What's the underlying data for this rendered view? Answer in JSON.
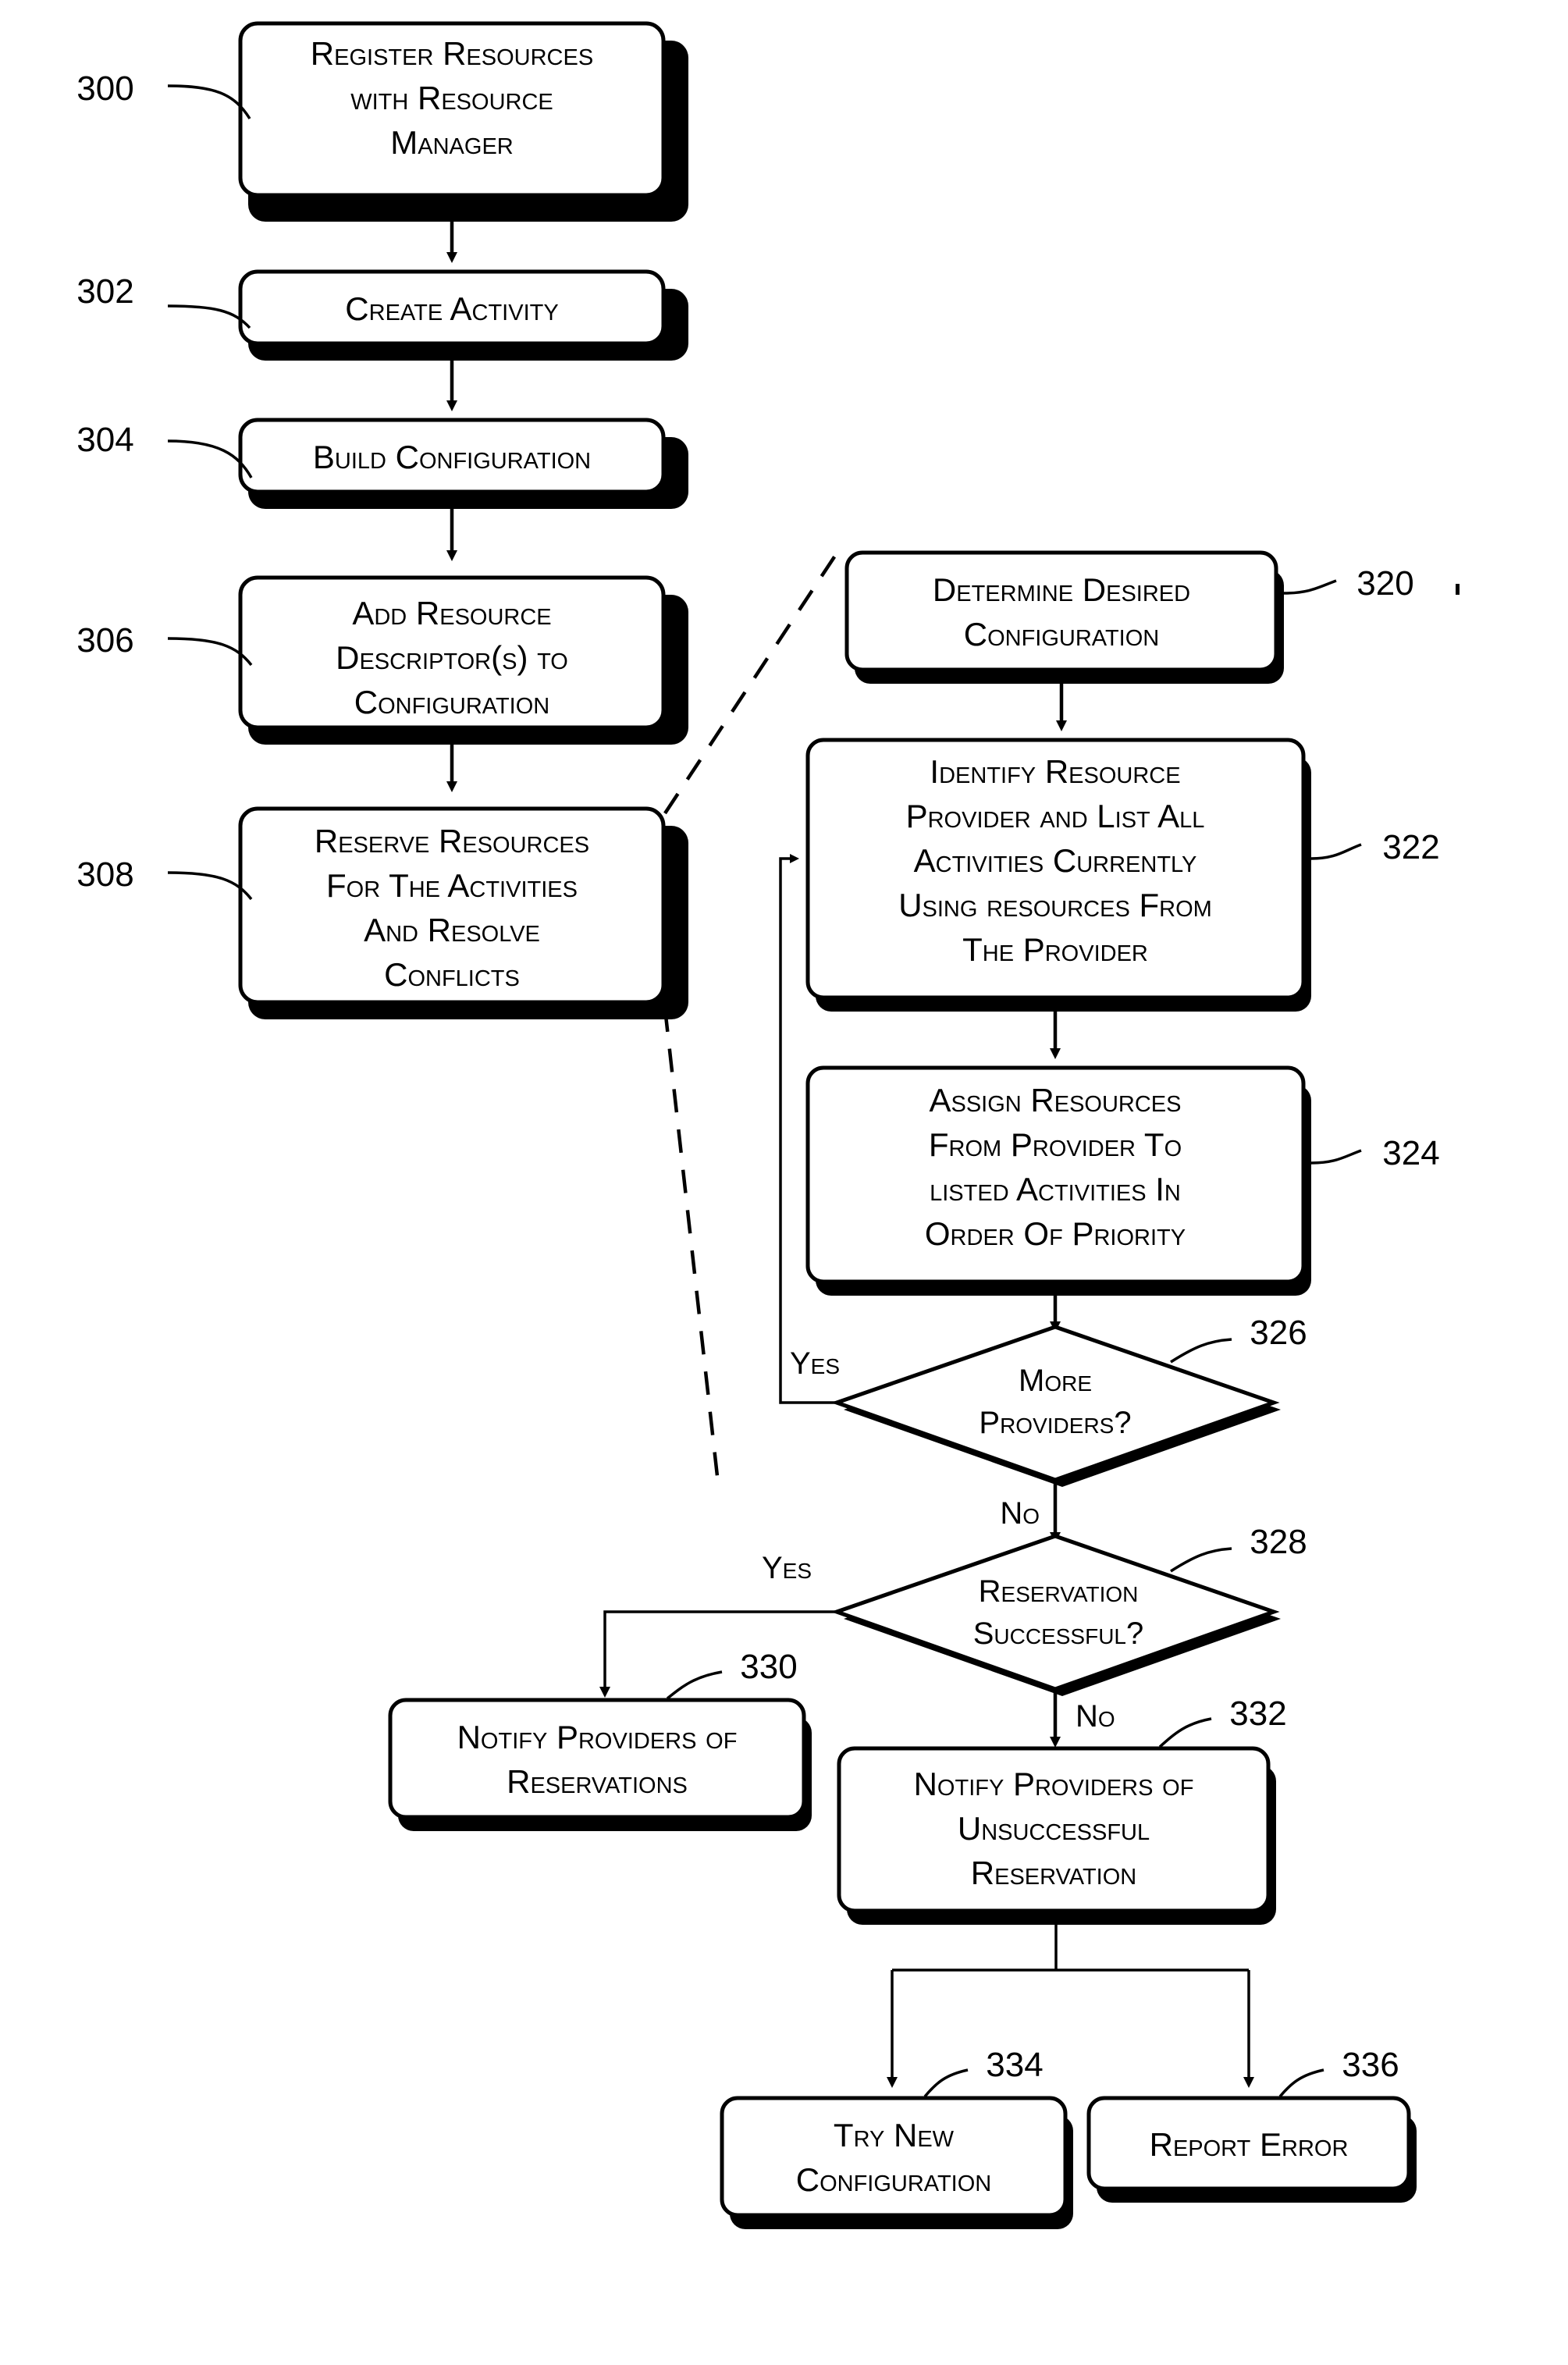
{
  "figure": {
    "type": "flowchart",
    "background_color": "#ffffff",
    "line_color": "#000000"
  },
  "nodes": [
    {
      "ref": "300",
      "shape": "process",
      "lines": [
        "Register Resources",
        "with Resource",
        "Manager"
      ]
    },
    {
      "ref": "302",
      "shape": "process",
      "lines": [
        "Create Activity"
      ]
    },
    {
      "ref": "304",
      "shape": "process",
      "lines": [
        "Build Configuration"
      ]
    },
    {
      "ref": "306",
      "shape": "process",
      "lines": [
        "Add Resource",
        "Descriptor(s) to",
        "Configuration"
      ]
    },
    {
      "ref": "308",
      "shape": "process",
      "lines": [
        "Reserve Resources",
        "For The Activities",
        "And Resolve",
        "Conflicts"
      ]
    },
    {
      "ref": "320",
      "shape": "process",
      "lines": [
        "Determine Desired",
        "Configuration"
      ]
    },
    {
      "ref": "322",
      "shape": "process",
      "lines": [
        "Identify Resource",
        "Provider and List All",
        "Activities Currently",
        "Using resources From",
        "The Provider"
      ]
    },
    {
      "ref": "324",
      "shape": "process",
      "lines": [
        "Assign Resources",
        "From Provider To",
        "listed Activities In",
        "Order Of Priority"
      ]
    },
    {
      "ref": "326",
      "shape": "decision",
      "lines": [
        "More",
        "Providers?"
      ]
    },
    {
      "ref": "328",
      "shape": "decision",
      "lines": [
        "Reservation",
        "Successful?"
      ]
    },
    {
      "ref": "330",
      "shape": "process",
      "lines": [
        "Notify Providers of",
        "Reservations"
      ]
    },
    {
      "ref": "332",
      "shape": "process",
      "lines": [
        "Notify Providers of",
        "Unsuccessful",
        "Reservation"
      ]
    },
    {
      "ref": "334",
      "shape": "process",
      "lines": [
        "Try New",
        "Configuration"
      ]
    },
    {
      "ref": "336",
      "shape": "process",
      "lines": [
        "Report Error"
      ]
    }
  ],
  "branch_labels": {
    "more_providers_yes": "Yes",
    "more_providers_no": "No",
    "reservation_yes": "Yes",
    "reservation_no": "No"
  }
}
